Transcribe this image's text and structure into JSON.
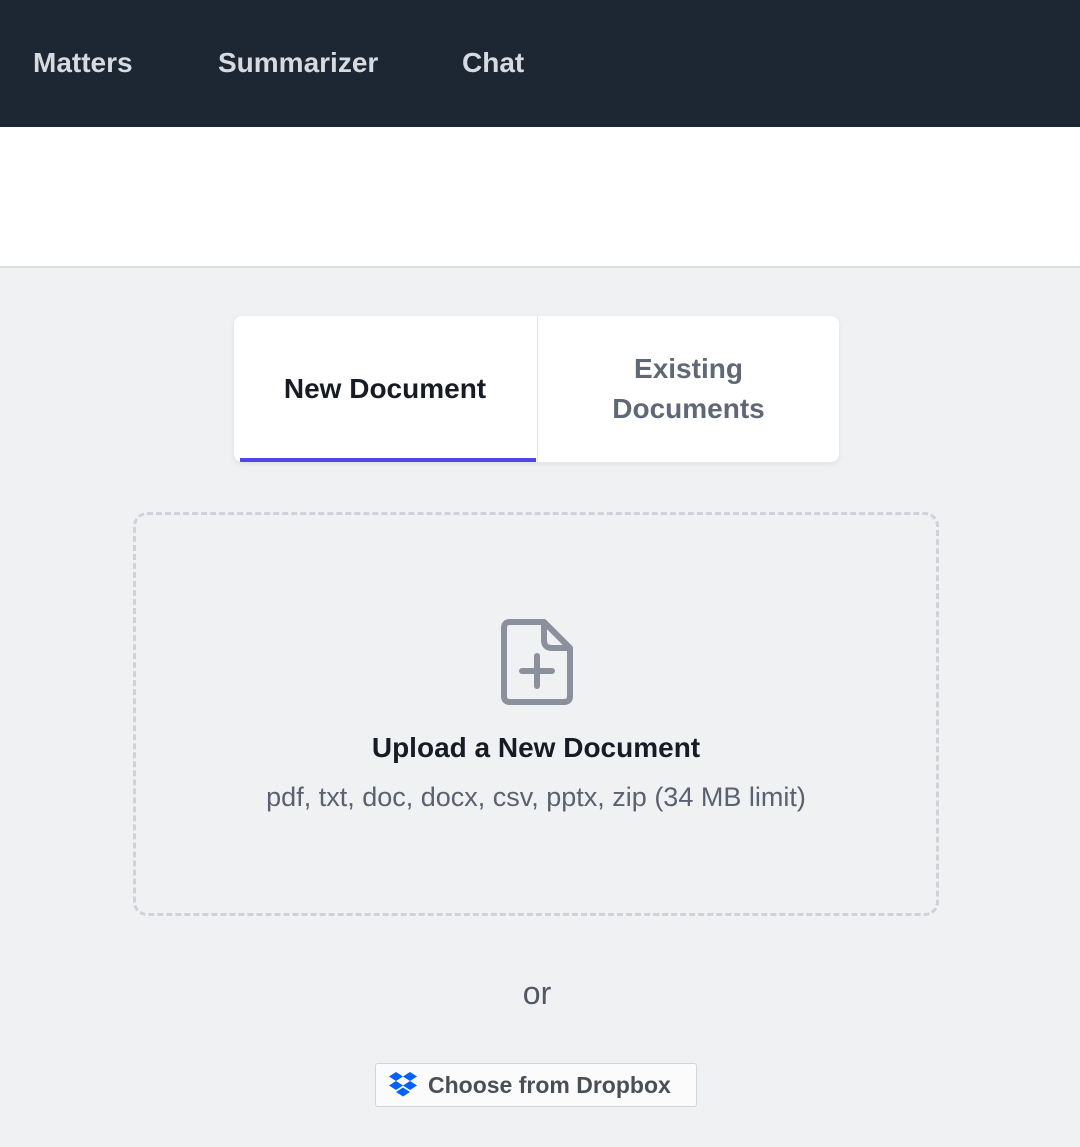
{
  "nav": {
    "items": [
      {
        "label": "Matters"
      },
      {
        "label": "Summarizer"
      },
      {
        "label": "Chat"
      }
    ]
  },
  "tabs": {
    "new_document": "New Document",
    "existing_documents": "Existing Documents",
    "active": "new_document",
    "accent_color": "#4f46e5"
  },
  "upload": {
    "icon": "file-plus-icon",
    "title": "Upload a New Document",
    "types": "pdf, txt, doc, docx, csv, pptx, zip (34 MB limit)"
  },
  "separator": "or",
  "dropbox": {
    "icon": "dropbox-icon",
    "label": "Choose from Dropbox",
    "brand_color": "#0061fe"
  }
}
